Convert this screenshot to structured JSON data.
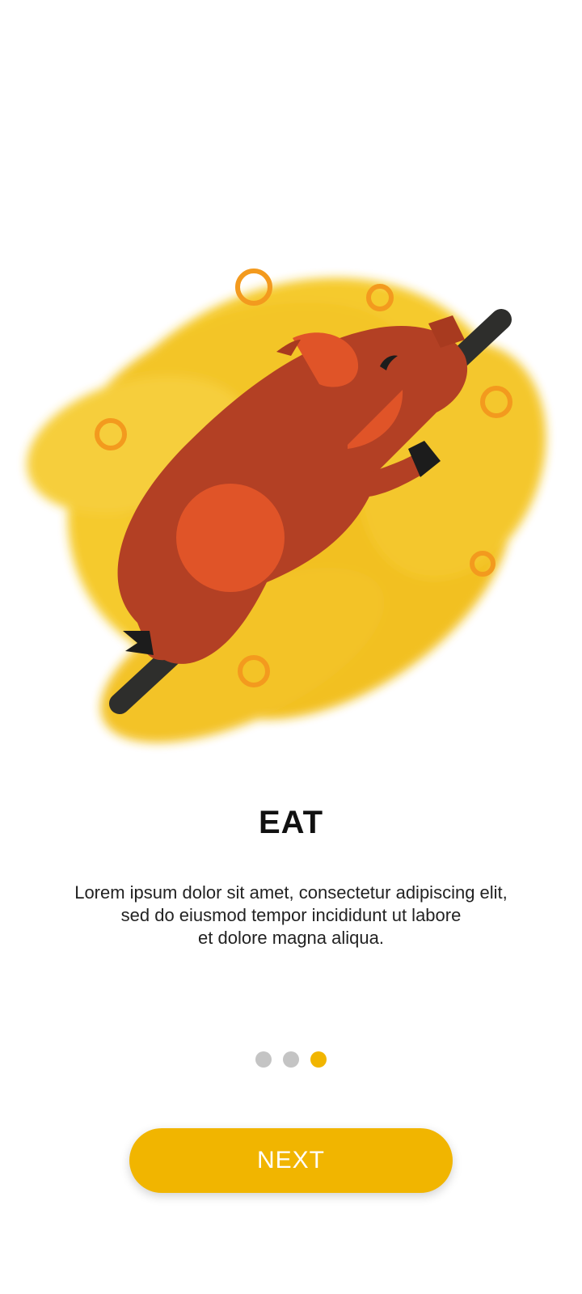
{
  "onboarding": {
    "title": "EAT",
    "description_lines": [
      "Lorem ipsum dolor sit amet, consectetur adipiscing elit,",
      "sed do eiusmod tempor incididunt ut labore",
      "et dolore magna aliqua."
    ],
    "illustration_icon": "roast-pig-illustration",
    "page_indicator": {
      "total": 3,
      "active_index": 2
    },
    "next_button_label": "NEXT"
  },
  "colors": {
    "accent": "#f1b500",
    "dot_inactive": "#c4c4c4",
    "pig_body": "#b34024",
    "pig_spots": "#e05428",
    "splash": "#f3c21a",
    "rings": "#f39a1e",
    "skewer": "#2e2e2c"
  }
}
